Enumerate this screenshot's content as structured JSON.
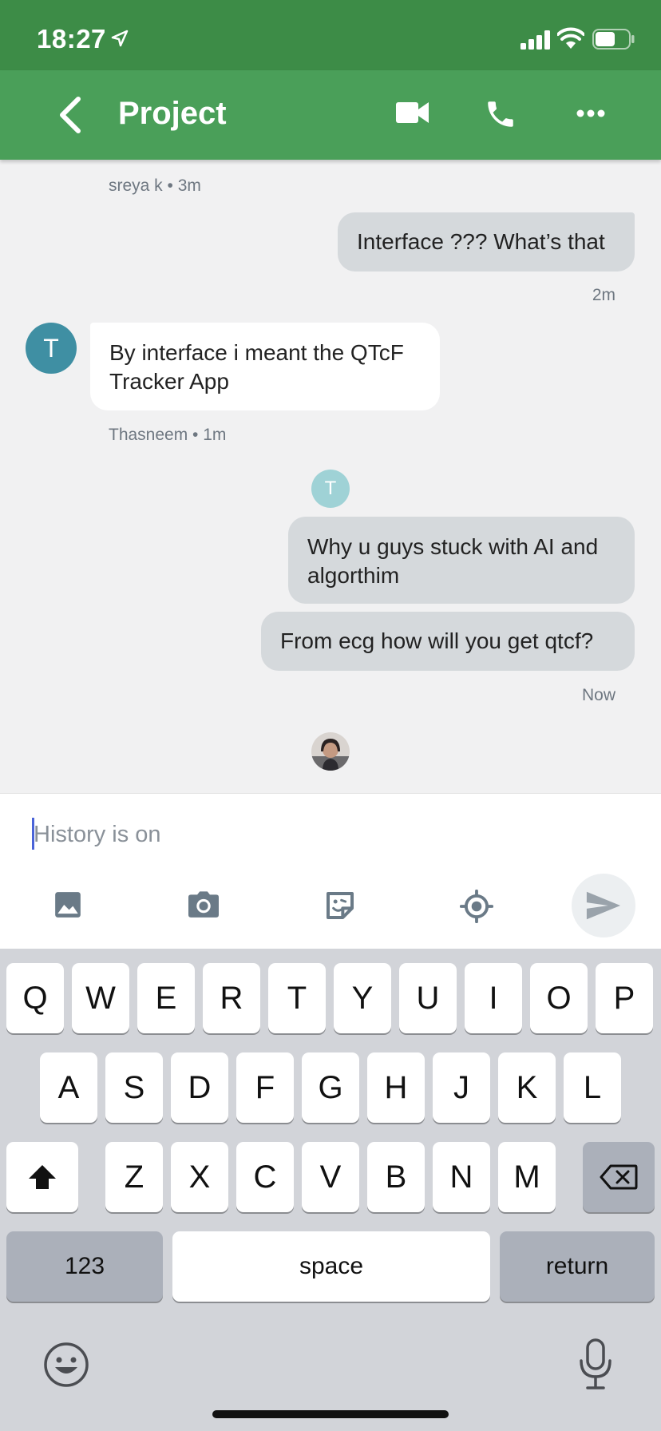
{
  "status_bar": {
    "time": "18:27"
  },
  "header": {
    "back_label": "back",
    "title": "Project"
  },
  "messages": {
    "m0_meta": "sreya k • 3m",
    "m1_text": "Interface ??? What’s that",
    "m1_time": "2m",
    "m2_avatar_letter": "T",
    "m2_text": "By interface i meant the QTcF Tracker App",
    "m2_meta": "Thasneem • 1m",
    "m3_avatar_letter": "T",
    "m3_text": "Why u guys stuck with AI and algorthim",
    "m4_text": "From ecg how will you get qtcf?",
    "m4_time": "Now"
  },
  "composer": {
    "placeholder": "History is on"
  },
  "keyboard": {
    "row1": [
      "Q",
      "W",
      "E",
      "R",
      "T",
      "Y",
      "U",
      "I",
      "O",
      "P"
    ],
    "row2": [
      "A",
      "S",
      "D",
      "F",
      "G",
      "H",
      "J",
      "K",
      "L"
    ],
    "row3": [
      "Z",
      "X",
      "C",
      "V",
      "B",
      "N",
      "M"
    ],
    "numbers": "123",
    "space": "space",
    "return": "return"
  },
  "colors": {
    "status_bar": "#3d8c47",
    "header": "#4a9f59",
    "avatar_primary": "#3f8fa3",
    "avatar_light": "#9fd2d6",
    "outgoing_bubble": "#d5d9dc",
    "incoming_bubble": "#ffffff",
    "keyboard_bg": "#d2d4d9"
  },
  "icons": [
    "location-arrow-icon",
    "signal-icon",
    "wifi-icon",
    "battery-icon",
    "back-icon",
    "video-camera-icon",
    "phone-icon",
    "more-icon",
    "image-icon",
    "camera-icon",
    "sticker-icon",
    "location-target-icon",
    "send-icon",
    "shift-icon",
    "backspace-icon",
    "emoji-icon",
    "microphone-icon"
  ]
}
